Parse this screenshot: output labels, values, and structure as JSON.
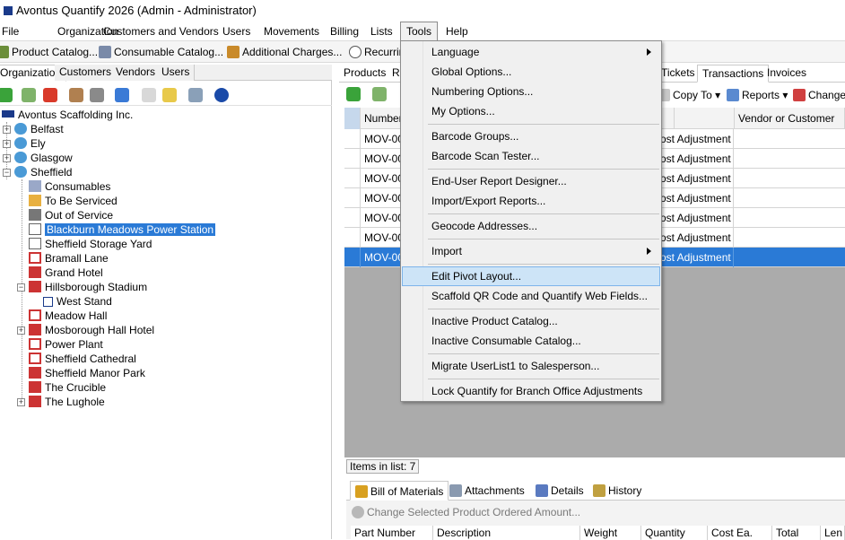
{
  "window": {
    "title": "Avontus Quantify 2026 (Admin - Administrator)"
  },
  "menubar": [
    "File",
    "Organization",
    "Customers and Vendors",
    "Users",
    "Movements",
    "Billing",
    "Lists",
    "Tools",
    "Help"
  ],
  "toolbar": {
    "product_catalog": "Product Catalog...",
    "consumable_catalog": "Consumable Catalog...",
    "additional_charges": "Additional Charges...",
    "recurring": "Recurring"
  },
  "left_tabs": [
    "Organization",
    "Customers",
    "Vendors",
    "Users"
  ],
  "tree": {
    "root": "Avontus Scaffolding Inc.",
    "belfast": "Belfast",
    "ely": "Ely",
    "glasgow": "Glasgow",
    "sheffield": "Sheffield",
    "consumables": "Consumables",
    "to_be_serviced": "To Be Serviced",
    "out_of_service": "Out of Service",
    "blackburn": "Blackburn Meadows Power Station",
    "storage_yard": "Sheffield Storage Yard",
    "bramall": "Bramall Lane",
    "grand_hotel": "Grand Hotel",
    "hillsborough": "Hillsborough Stadium",
    "west_stand": "West Stand",
    "meadow_hall": "Meadow Hall",
    "mosborough": "Mosborough Hall Hotel",
    "power_plant": "Power Plant",
    "cathedral": "Sheffield Cathedral",
    "manor_park": "Sheffield Manor Park",
    "crucible": "The Crucible",
    "lughole": "The Lughole"
  },
  "right_tabs": {
    "products": "Products",
    "r": "R",
    "tickets": "Tickets",
    "transactions": "Transactions",
    "invoices": "Invoices"
  },
  "right_toolbar": {
    "copy_to": "Copy To",
    "reports": "Reports",
    "change": "Change"
  },
  "grid": {
    "headers": {
      "number": "Number",
      "vendor_customer": "Vendor or Customer"
    },
    "rows": [
      {
        "number": "MOV-00",
        "type": "ost Adjustment"
      },
      {
        "number": "MOV-00",
        "type": "ost Adjustment"
      },
      {
        "number": "MOV-00",
        "type": "ost Adjustment"
      },
      {
        "number": "MOV-00",
        "type": "ost Adjustment"
      },
      {
        "number": "MOV-00",
        "type": "ost Adjustment"
      },
      {
        "number": "MOV-00",
        "type": "ost Adjustment"
      },
      {
        "number": "MOV-00",
        "type": "ost Adjustment"
      }
    ]
  },
  "status": {
    "items_in_list": "Items in list: 7"
  },
  "bottom_tabs": [
    "Bill of Materials",
    "Attachments",
    "Details",
    "History"
  ],
  "bottom": {
    "change_amount": "Change Selected Product Ordered Amount...",
    "columns": [
      "Part Number",
      "Description",
      "Weight",
      "Quantity",
      "Cost Ea.",
      "Total",
      "Len"
    ]
  },
  "tools_menu": {
    "language": "Language",
    "global_options": "Global Options...",
    "numbering_options": "Numbering Options...",
    "my_options": "My Options...",
    "barcode_groups": "Barcode Groups...",
    "barcode_scan_tester": "Barcode Scan Tester...",
    "report_designer": "End-User Report Designer...",
    "import_export_reports": "Import/Export Reports...",
    "geocode": "Geocode Addresses...",
    "import": "Import",
    "edit_pivot": "Edit Pivot Layout...",
    "qr_code": "Scaffold QR Code and Quantify Web Fields...",
    "inactive_product": "Inactive Product Catalog...",
    "inactive_consumable": "Inactive Consumable Catalog...",
    "migrate_userlist": "Migrate UserList1 to Salesperson...",
    "lock_quantify": "Lock Quantify for Branch Office Adjustments"
  }
}
